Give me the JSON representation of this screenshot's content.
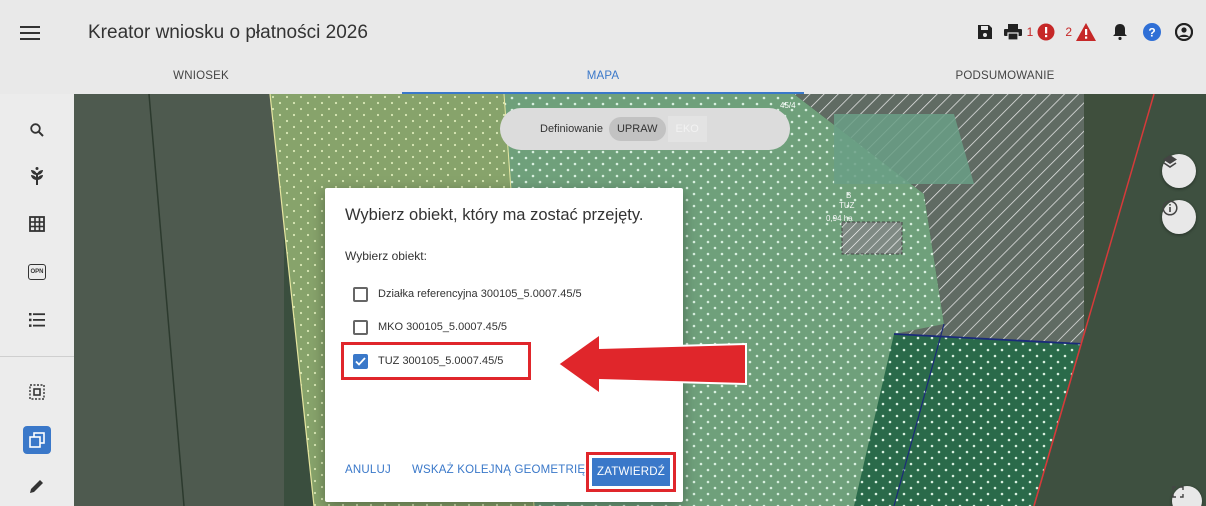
{
  "header": {
    "title": "Kreator wniosku o płatności 2026",
    "error_count": "1",
    "warning_count": "2"
  },
  "tabs": [
    {
      "label": "WNIOSEK",
      "active": false
    },
    {
      "label": "MAPA",
      "active": true
    },
    {
      "label": "PODSUMOWANIE",
      "active": false
    }
  ],
  "toolbar": {
    "icons": [
      "search-icon",
      "plant-icon",
      "grid-icon",
      "opn-icon",
      "list-icon",
      "select-area-icon",
      "copy-geometry-icon",
      "pencil-icon"
    ],
    "opn_label": "OPN"
  },
  "map": {
    "mode_toggle": {
      "label": "Definiowanie",
      "option_active": "UPRAW",
      "option_inactive": "EKO"
    },
    "parcel_number": "45/4",
    "label_letter": "B",
    "label_type": "TUZ",
    "label_area": "0,94 ha"
  },
  "dialog": {
    "title": "Wybierz obiekt, który ma zostać przejęty.",
    "subtitle": "Wybierz obiekt:",
    "options": [
      {
        "label": "Działka referencyjna 300105_5.0007.45/5",
        "checked": false
      },
      {
        "label": "MKO 300105_5.0007.45/5",
        "checked": false
      },
      {
        "label": "TUZ 300105_5.0007.45/5",
        "checked": true
      }
    ],
    "cancel_label": "ANULUJ",
    "next_geometry_label": "WSKAŻ KOLEJNĄ GEOMETRIĘ",
    "confirm_label": "ZATWIERDŹ"
  },
  "colors": {
    "accent": "#3a78c9",
    "highlight_red": "#e0262b",
    "error_red": "#c62828",
    "help_blue": "#2f6fd6"
  }
}
